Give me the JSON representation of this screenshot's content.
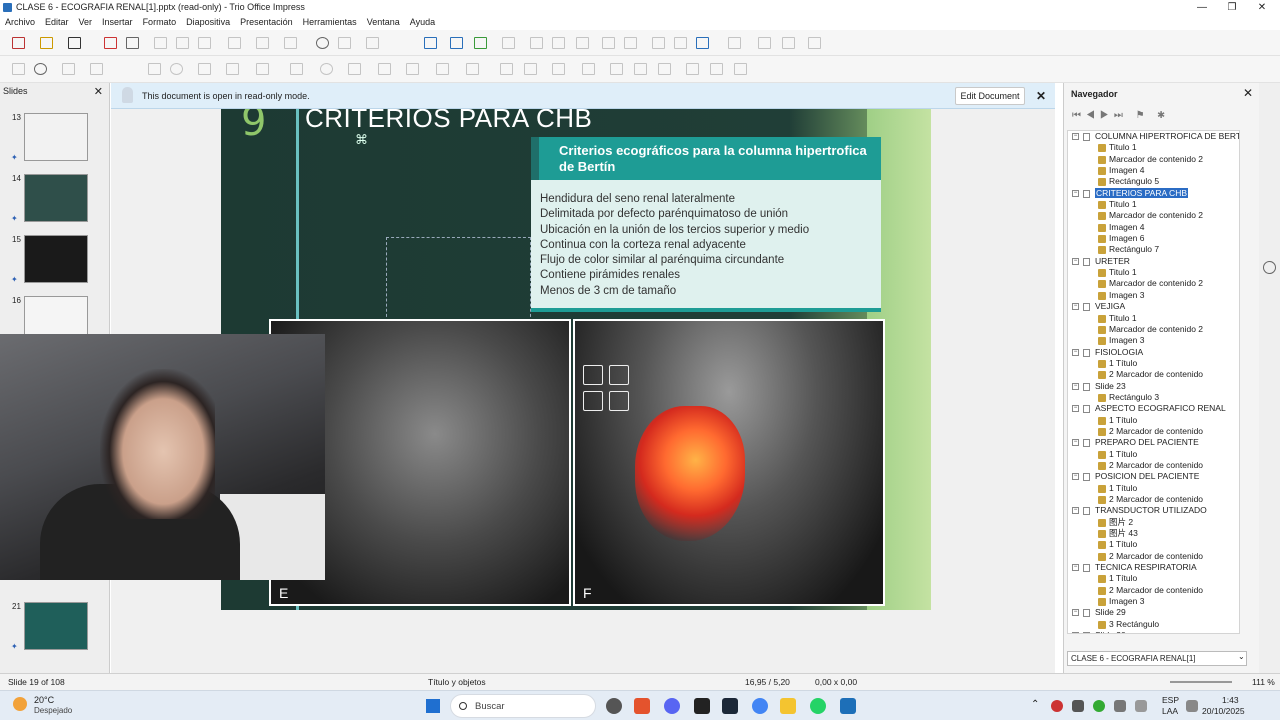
{
  "window": {
    "title": "CLASE 6 - ECOGRAFIA RENAL[1].pptx (read-only) - Trio Office Impress"
  },
  "menu": [
    "Archivo",
    "Editar",
    "Ver",
    "Insertar",
    "Formato",
    "Diapositiva",
    "Presentación",
    "Herramientas",
    "Ventana",
    "Ayuda"
  ],
  "slides_pane": {
    "title": "Slides",
    "thumbs": [
      {
        "num": "13",
        "color": "#f2f2f2"
      },
      {
        "num": "14",
        "color": "#2f4f4a"
      },
      {
        "num": "15",
        "color": "#1a1a1a"
      },
      {
        "num": "16",
        "color": "#f5f5f5"
      },
      {
        "num": "21",
        "color": "#1f5f5a"
      }
    ]
  },
  "infobar": {
    "message": "This document is open in read-only mode.",
    "edit_button": "Edit Document"
  },
  "slide": {
    "number": "9",
    "title": "CRITERIOS PARA CHB",
    "symbol": "⌘",
    "criteria_header": "Criterios ecográficos para la columna hipertrofica de Bertín",
    "criteria": [
      "Hendidura del seno renal lateralmente",
      "Delimitada por defecto parénquimatoso de unión",
      "Ubicación en la unión de los tercios superior y medio",
      "Continua con la corteza renal adyacente",
      "Flujo de color similar al parénquima circundante",
      "Contiene pirámides renales",
      "Menos de 3 cm de tamaño"
    ],
    "image_e_label": "E",
    "image_f_label": "F"
  },
  "navigator": {
    "title": "Navegador",
    "tree": [
      {
        "level": 0,
        "label": "COLUMNA HIPERTROFICA DE BERTIN"
      },
      {
        "level": 1,
        "label": "Titulo 1"
      },
      {
        "level": 1,
        "label": "Marcador de contenido 2"
      },
      {
        "level": 1,
        "label": "Imagen 4"
      },
      {
        "level": 1,
        "label": "Rectángulo 5"
      },
      {
        "level": 0,
        "label": "CRITERIOS PARA CHB",
        "selected": true
      },
      {
        "level": 1,
        "label": "Titulo 1"
      },
      {
        "level": 1,
        "label": "Marcador de contenido 2"
      },
      {
        "level": 1,
        "label": "Imagen 4"
      },
      {
        "level": 1,
        "label": "Imagen 6"
      },
      {
        "level": 1,
        "label": "Rectángulo 7"
      },
      {
        "level": 0,
        "label": "URETER"
      },
      {
        "level": 1,
        "label": "Titulo 1"
      },
      {
        "level": 1,
        "label": "Marcador de contenido 2"
      },
      {
        "level": 1,
        "label": "Imagen 3"
      },
      {
        "level": 0,
        "label": "VEJIGA"
      },
      {
        "level": 1,
        "label": "Titulo 1"
      },
      {
        "level": 1,
        "label": "Marcador de contenido 2"
      },
      {
        "level": 1,
        "label": "Imagen 3"
      },
      {
        "level": 0,
        "label": "FISIOLOGIA"
      },
      {
        "level": 1,
        "label": "1 Título"
      },
      {
        "level": 1,
        "label": "2 Marcador de contenido"
      },
      {
        "level": 0,
        "label": "Slide 23"
      },
      {
        "level": 1,
        "label": "Rectángulo 3"
      },
      {
        "level": 0,
        "label": "ASPECTO ECOGRAFICO RENAL"
      },
      {
        "level": 1,
        "label": "1 Título"
      },
      {
        "level": 1,
        "label": "2 Marcador de contenido"
      },
      {
        "level": 0,
        "label": "PREPARO DEL PACIENTE"
      },
      {
        "level": 1,
        "label": "1 Título"
      },
      {
        "level": 1,
        "label": "2 Marcador de contenido"
      },
      {
        "level": 0,
        "label": "POSICION DEL PACIENTE"
      },
      {
        "level": 1,
        "label": "1 Título"
      },
      {
        "level": 1,
        "label": "2 Marcador de contenido"
      },
      {
        "level": 0,
        "label": "TRANSDUCTOR UTILIZADO"
      },
      {
        "level": 1,
        "label": "图片 2"
      },
      {
        "level": 1,
        "label": "图片 43"
      },
      {
        "level": 1,
        "label": "1 Título"
      },
      {
        "level": 1,
        "label": "2 Marcador de contenido"
      },
      {
        "level": 0,
        "label": "TECNICA RESPIRATORIA"
      },
      {
        "level": 1,
        "label": "1 Título"
      },
      {
        "level": 1,
        "label": "2 Marcador de contenido"
      },
      {
        "level": 1,
        "label": "Imagen 3"
      },
      {
        "level": 0,
        "label": "Slide 29"
      },
      {
        "level": 1,
        "label": "3 Rectángulo"
      },
      {
        "level": 0,
        "label": "Slide 30"
      }
    ],
    "document": "CLASE 6 - ECOGRAFIA RENAL[1]"
  },
  "statusbar": {
    "slide": "Slide 19 of 108",
    "layout": "Título y objetos",
    "position": "16,95 / 5,20",
    "size": "0,00 x 0,00",
    "zoom": "111 %"
  },
  "taskbar": {
    "weather_temp": "20°C",
    "weather_desc": "Despejado",
    "search": "Buscar",
    "lang1": "ESP",
    "lang2": "LAA",
    "time": "1:43",
    "date": "20/10/2025"
  }
}
